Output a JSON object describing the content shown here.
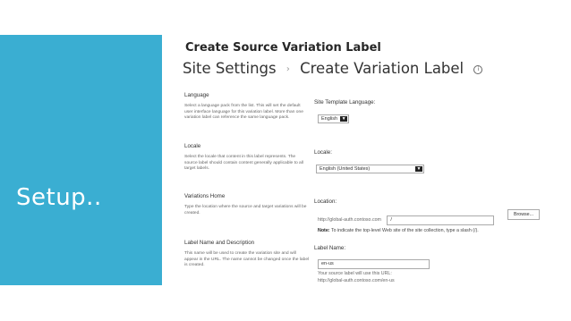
{
  "sidebar": {
    "title": "Setup.."
  },
  "slide": {
    "title": "Create Source Variation Label"
  },
  "header": {
    "breadcrumb_root": "Site Settings",
    "separator": "›",
    "current": "Create Variation Label",
    "info_icon": "i"
  },
  "sections": {
    "language": {
      "title": "Language",
      "description": "Select a language pack from the list. This will set the default user interface language for this variation label. More than one variation label can reference the same language pack.",
      "field_label": "Site Template Language:",
      "value": "English"
    },
    "locale": {
      "title": "Locale",
      "description": "Select the locale that content in this label represents. The source label should contain content generally applicable to all target labels.",
      "field_label": "Locale:",
      "value": "English (United States)"
    },
    "variations_home": {
      "title": "Variations Home",
      "description": "Type the location where the source and target variations will be created.",
      "field_label": "Location:",
      "url_prefix": "http://global-auth.contoso.com",
      "value": "/",
      "browse_label": "Browse...",
      "note_bold": "Note:",
      "note_text": "To indicate the top-level Web site of the site collection, type a slash (/)."
    },
    "label_name": {
      "title": "Label Name and Description",
      "description": "This name will be used to create the variation site and will appear in the URL. The name cannot be changed once the label is created.",
      "field_label": "Label Name:",
      "value": "en-us",
      "url_hint": "Your source label will use this URL:",
      "url_value": "http://global-auth.contoso.com/en-us"
    }
  }
}
